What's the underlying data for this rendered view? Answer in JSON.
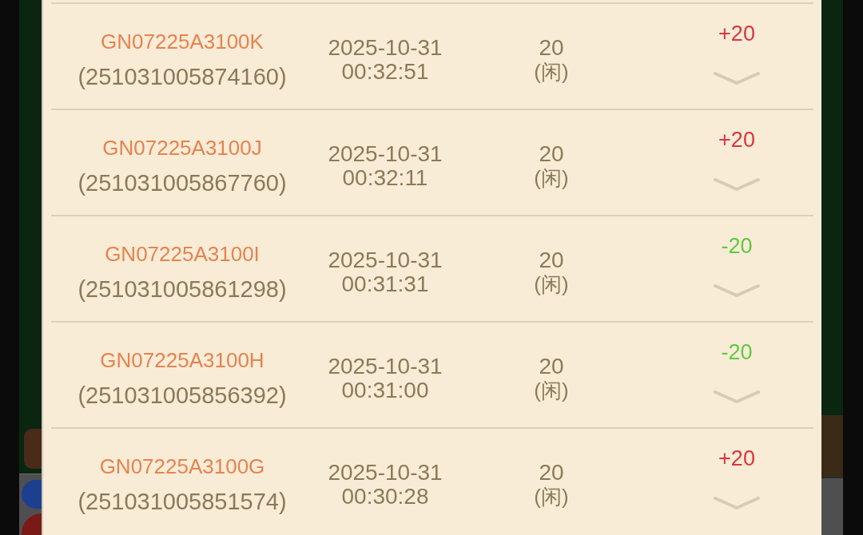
{
  "records": [
    {
      "round": "GN07225A3100K",
      "order_no": "(251031005874160)",
      "date": "2025-10-31",
      "time": "00:32:51",
      "amount": "20",
      "side": "(闲)",
      "result": "+20",
      "color": "#d9363e",
      "expanded": false
    },
    {
      "round": "GN07225A3100J",
      "order_no": "(251031005867760)",
      "date": "2025-10-31",
      "time": "00:32:11",
      "amount": "20",
      "side": "(闲)",
      "result": "+20",
      "color": "#d9363e",
      "expanded": false
    },
    {
      "round": "GN07225A3100I",
      "order_no": "(251031005861298)",
      "date": "2025-10-31",
      "time": "00:31:31",
      "amount": "20",
      "side": "(闲)",
      "result": "-20",
      "color": "#5fc93f",
      "expanded": false
    },
    {
      "round": "GN07225A3100H",
      "order_no": "(251031005856392)",
      "date": "2025-10-31",
      "time": "00:31:00",
      "amount": "20",
      "side": "(闲)",
      "result": "-20",
      "color": "#5fc93f",
      "expanded": false
    },
    {
      "round": "GN07225A3100G",
      "order_no": "(251031005851574)",
      "date": "2025-10-31",
      "time": "00:30:28",
      "amount": "20",
      "side": "(闲)",
      "result": "+20",
      "color": "#d9363e",
      "expanded": false
    }
  ]
}
